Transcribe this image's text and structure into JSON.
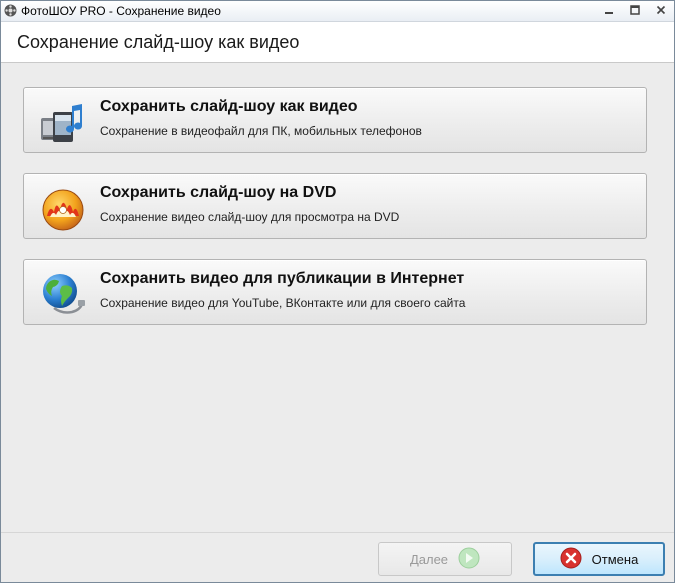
{
  "window": {
    "title": "ФотоШОУ PRO - Сохранение видео",
    "minimize_icon": "minimize-icon",
    "maximize_icon": "maximize-icon",
    "close_icon": "close-icon"
  },
  "header": {
    "title": "Сохранение слайд-шоу как видео"
  },
  "options": [
    {
      "title": "Сохранить слайд-шоу как видео",
      "description": "Сохранение в видеофайл для ПК, мобильных телефонов",
      "icon": "video-devices-icon"
    },
    {
      "title": "Сохранить слайд-шоу на DVD",
      "description": "Сохранение видео слайд-шоу для просмотра на DVD",
      "icon": "dvd-disc-icon"
    },
    {
      "title": "Сохранить видео для публикации в Интернет",
      "description": "Сохранение видео для YouTube, ВКонтакте или для своего сайта",
      "icon": "globe-network-icon"
    }
  ],
  "footer": {
    "next_label": "Далее",
    "next_enabled": false,
    "cancel_label": "Отмена"
  },
  "colors": {
    "accent": "#3c7fb1",
    "cancel_icon": "#d8322e",
    "next_icon": "#8fd18f"
  }
}
